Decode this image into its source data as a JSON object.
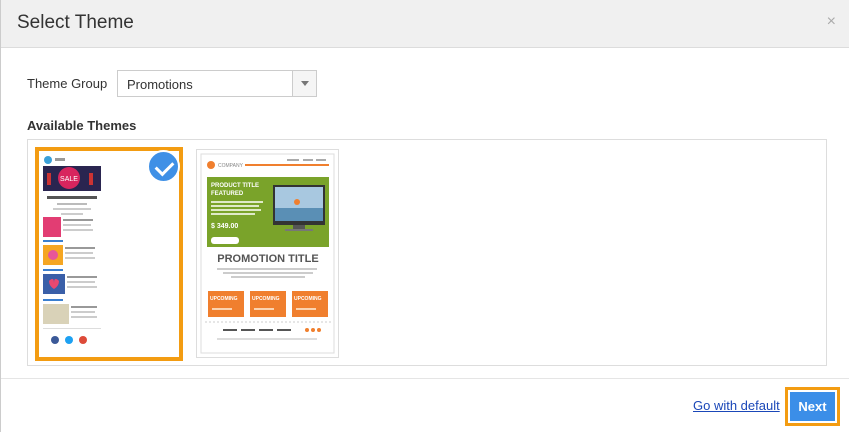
{
  "dialog": {
    "title": "Select Theme",
    "close_glyph": "×"
  },
  "form": {
    "group_label": "Theme Group",
    "group_value": "Promotions",
    "available_label": "Available Themes"
  },
  "themes": [
    {
      "selected": true,
      "sale": "SALE"
    },
    {
      "selected": false,
      "company": "COMPANY",
      "product_title": "PRODUCT TITLE",
      "featured": "FEATURED",
      "price": "$ 349.00",
      "promo_title": "PROMOTION TITLE",
      "upcoming": "UPCOMING"
    }
  ],
  "footer": {
    "default_link": "Go with default",
    "next_label": "Next"
  },
  "colors": {
    "accent_orange": "#f39c12",
    "button_blue": "#3b8ee8",
    "check_blue": "#3f90e6",
    "link_blue": "#1a47b8",
    "theme_green": "#7aa32a",
    "theme_orange": "#f07f2e"
  }
}
